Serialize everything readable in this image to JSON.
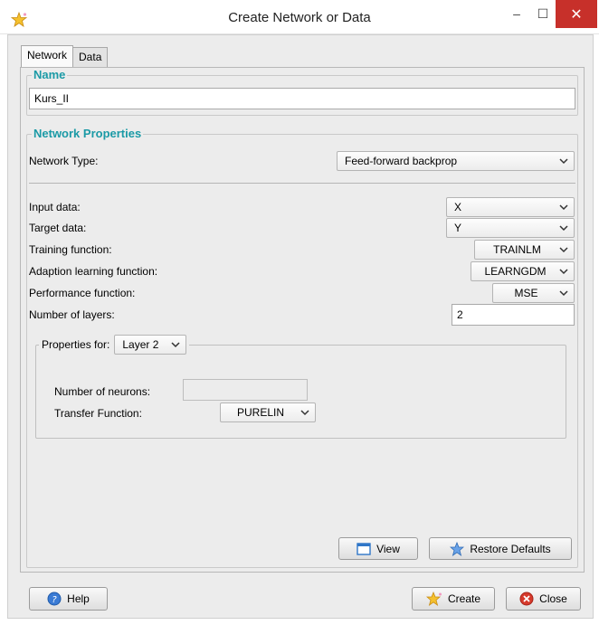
{
  "window": {
    "title": "Create Network or Data",
    "minimize_glyph": "–",
    "maximize_glyph": "☐",
    "close_glyph": "✕"
  },
  "tabs": [
    {
      "label": "Network",
      "active": true
    },
    {
      "label": "Data",
      "active": false
    }
  ],
  "name_group": {
    "title": "Name",
    "value": "Kurs_II"
  },
  "network_properties": {
    "title": "Network Properties",
    "network_type_label": "Network Type:",
    "network_type_value": "Feed-forward backprop",
    "input_data_label": "Input data:",
    "input_data_value": "X",
    "target_data_label": "Target data:",
    "target_data_value": "Y",
    "training_function_label": "Training function:",
    "training_function_value": "TRAINLM",
    "adaption_function_label": "Adaption learning function:",
    "adaption_function_value": "LEARNGDM",
    "performance_function_label": "Performance function:",
    "performance_function_value": "MSE",
    "layers_label": "Number of layers:",
    "layers_value": "2"
  },
  "layer_properties": {
    "title": "Properties for:",
    "layer_value": "Layer 2",
    "neurons_label": "Number of neurons:",
    "neurons_value": "",
    "transfer_label": "Transfer Function:",
    "transfer_value": "PURELIN"
  },
  "buttons": {
    "view": "View",
    "restore_defaults": "Restore Defaults",
    "help": "Help",
    "create": "Create",
    "close": "Close"
  },
  "icons": {
    "app": "star-sparkle-icon",
    "view": "window-icon",
    "restore": "star-icon",
    "help": "help-icon",
    "create": "star-sparkle-icon",
    "close": "close-circle-icon"
  },
  "colors": {
    "accent_title": "#1b9aa6",
    "close_button": "#c7302a"
  }
}
